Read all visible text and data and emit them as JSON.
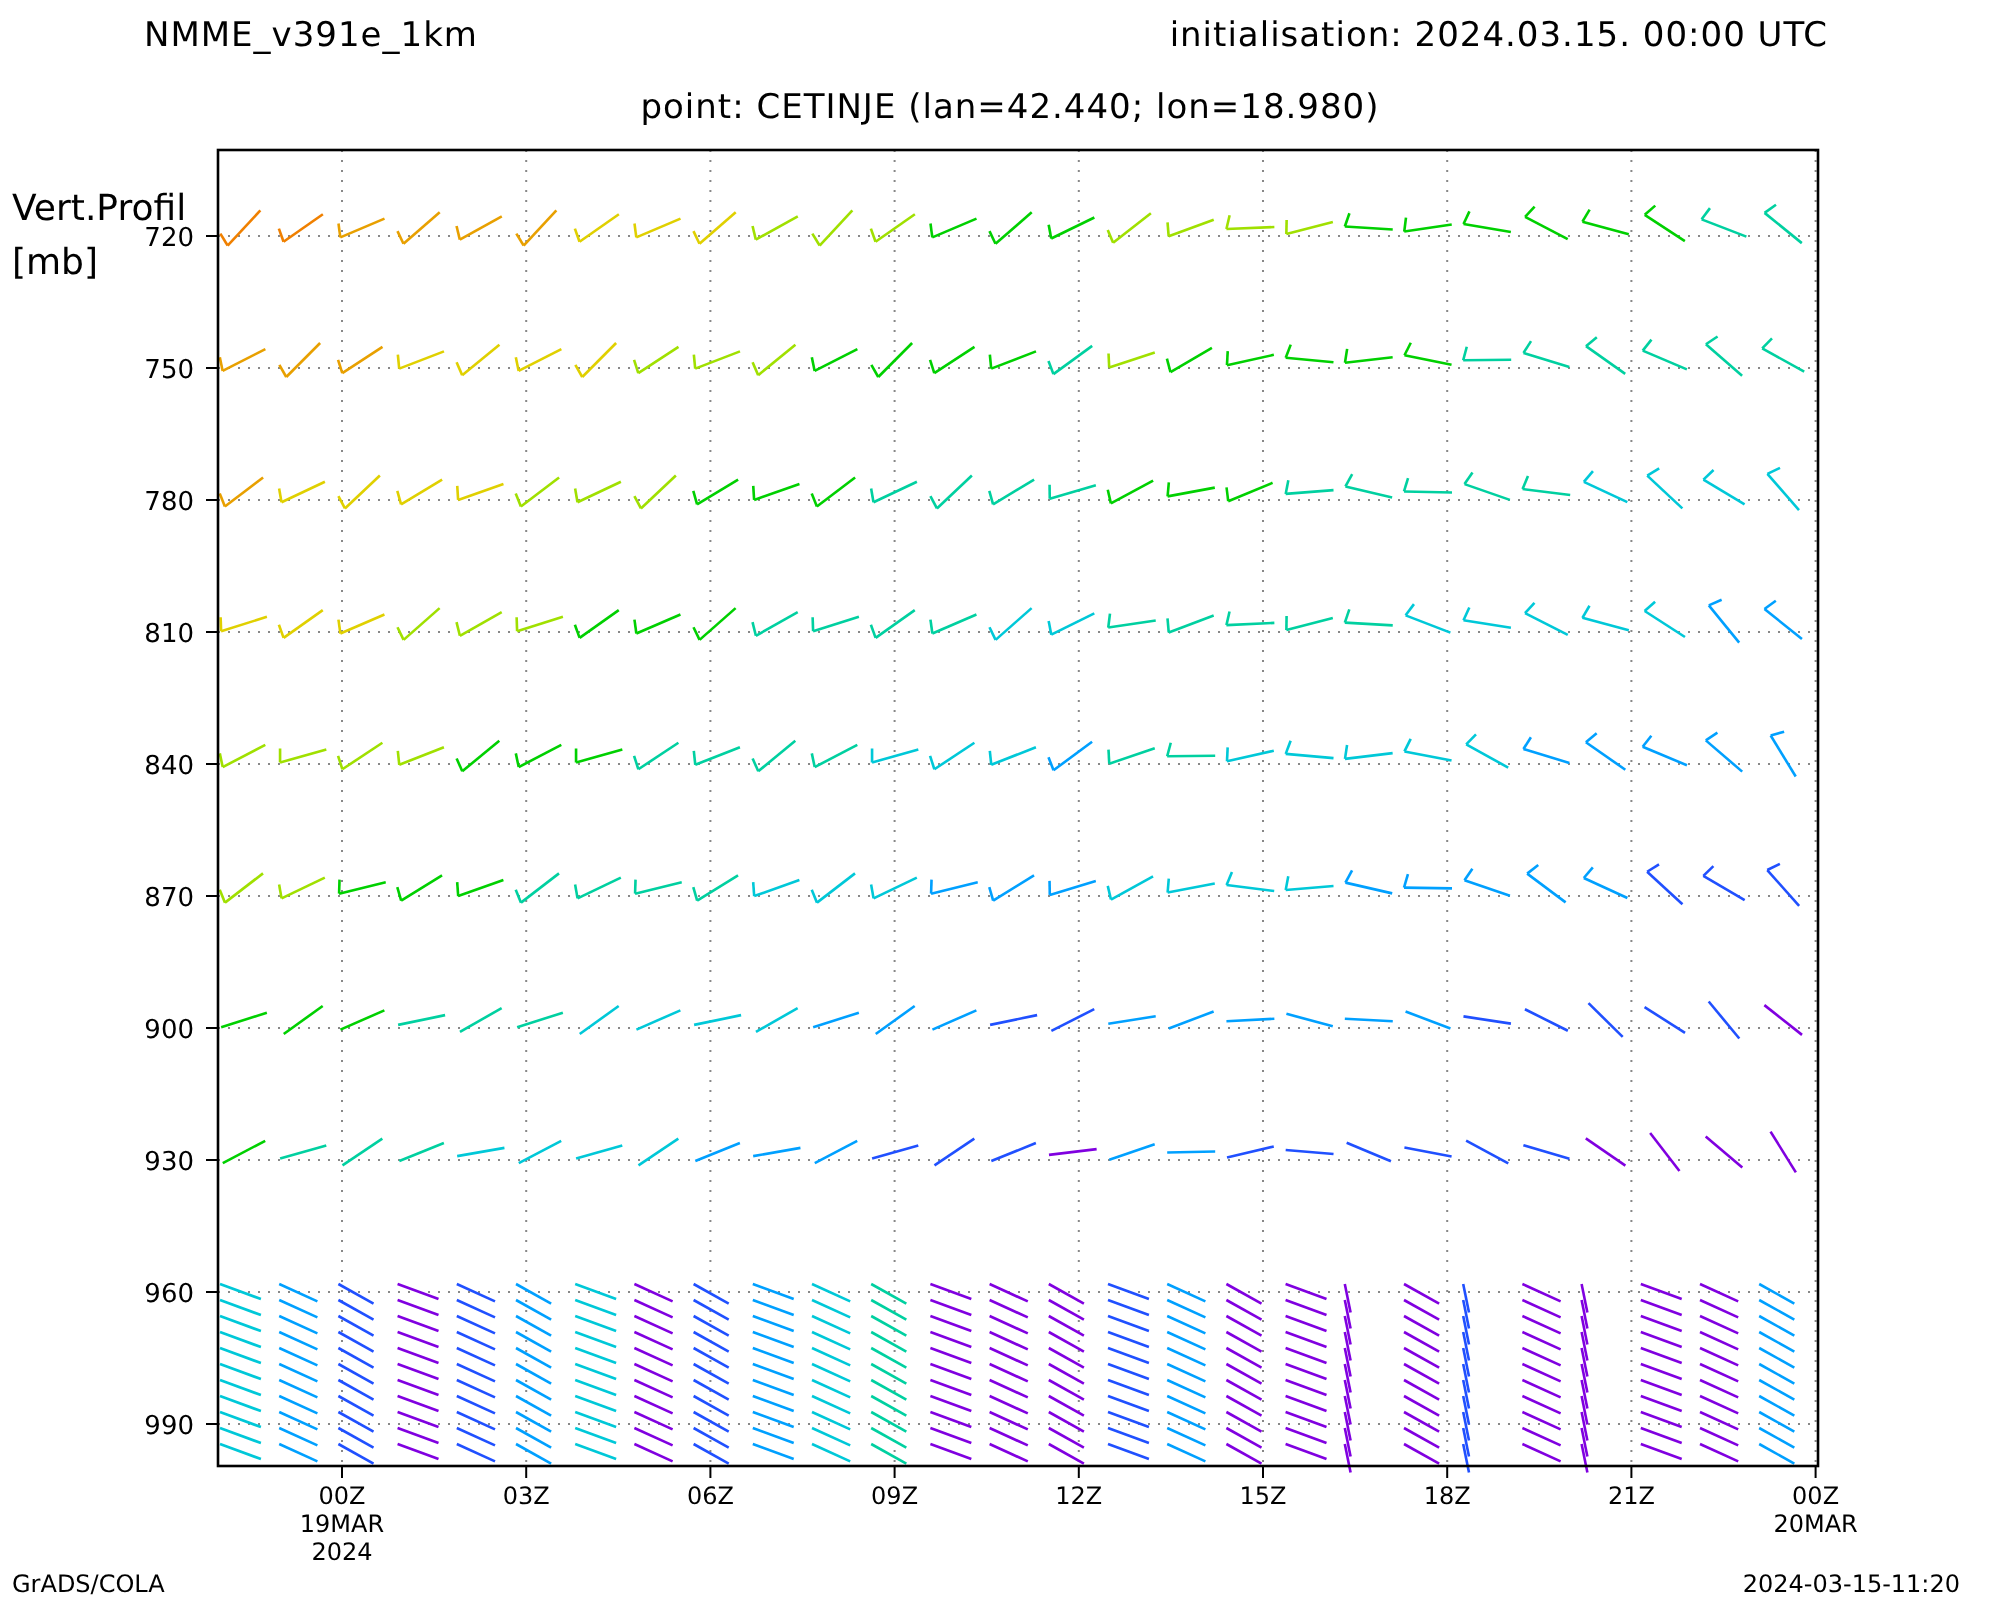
{
  "header": {
    "model": "NMME_v391e_1km",
    "initialisation": "initialisation: 2024.03.15. 00:00 UTC"
  },
  "subtitle": "point: CETINJE (lan=42.440; lon=18.980)",
  "y_axis": {
    "title": [
      "Vert.Profil",
      "[mb]"
    ],
    "ticks": [
      "720",
      "750",
      "780",
      "810",
      "840",
      "870",
      "900",
      "930",
      "960",
      "990"
    ]
  },
  "x_axis": {
    "ticks": [
      {
        "label": "00Z",
        "lines": [
          "19MAR",
          "2024"
        ]
      },
      {
        "label": "03Z"
      },
      {
        "label": "06Z"
      },
      {
        "label": "09Z"
      },
      {
        "label": "12Z"
      },
      {
        "label": "15Z"
      },
      {
        "label": "18Z"
      },
      {
        "label": "21Z"
      },
      {
        "label": "00Z",
        "lines": [
          "20MAR"
        ]
      }
    ]
  },
  "footer": {
    "left": "GrADS/COLA",
    "right": "2024-03-15-11:20"
  }
}
